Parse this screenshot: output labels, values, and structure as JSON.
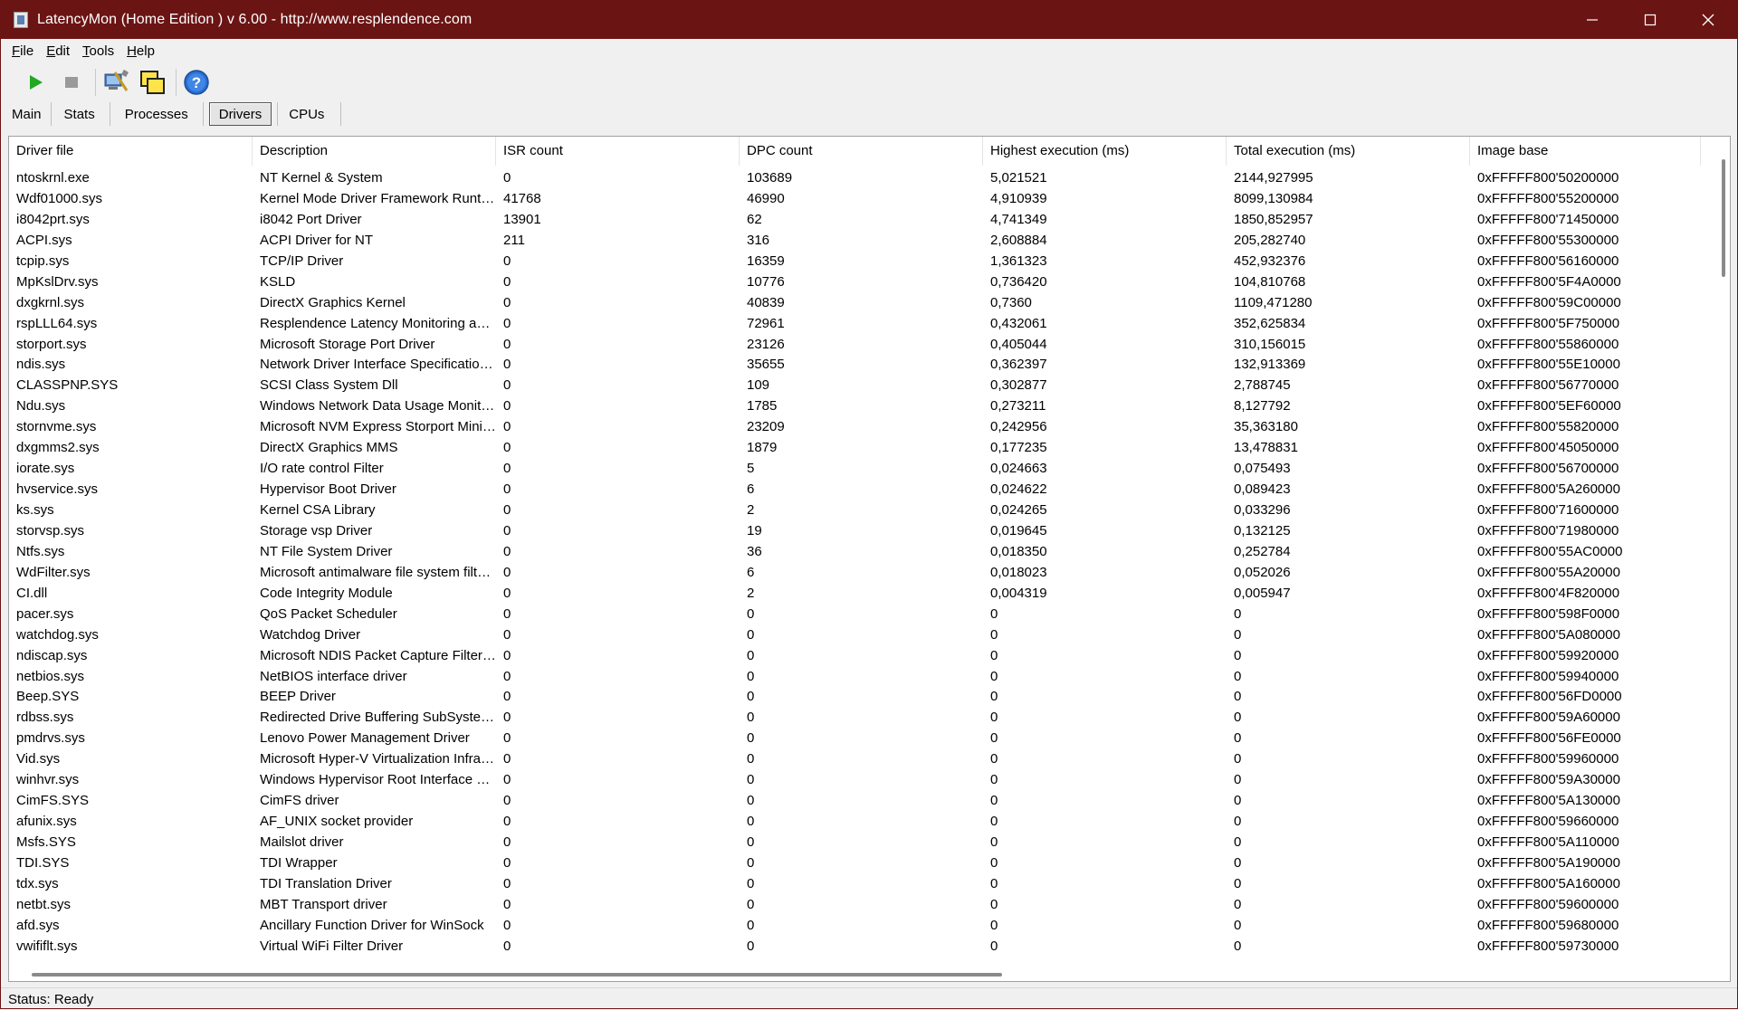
{
  "window": {
    "title": "LatencyMon  (Home Edition )  v 6.00 - http://www.resplendence.com"
  },
  "menu": [
    {
      "label": "File"
    },
    {
      "label": "Edit"
    },
    {
      "label": "Tools"
    },
    {
      "label": "Help"
    }
  ],
  "toolbar": {
    "icons": [
      "play-icon",
      "stop-icon",
      "computer-tools-icon",
      "windows-icon",
      "help-icon"
    ]
  },
  "tabs": [
    {
      "label": "Main",
      "active": false
    },
    {
      "label": "Stats",
      "active": false
    },
    {
      "label": "Processes",
      "active": false
    },
    {
      "label": "Drivers",
      "active": true
    },
    {
      "label": "CPUs",
      "active": false
    }
  ],
  "table": {
    "columns": [
      "Driver file",
      "Description",
      "ISR count",
      "DPC count",
      "Highest execution (ms)",
      "Total execution (ms)",
      "Image base"
    ],
    "rows": [
      [
        "ntoskrnl.exe",
        "NT Kernel & System",
        "0",
        "103689",
        "5,021521",
        "2144,927995",
        "0xFFFFF800'50200000"
      ],
      [
        "Wdf01000.sys",
        "Kernel Mode Driver Framework Runtime",
        "41768",
        "46990",
        "4,910939",
        "8099,130984",
        "0xFFFFF800'55200000"
      ],
      [
        "i8042prt.sys",
        "i8042 Port Driver",
        "13901",
        "62",
        "4,741349",
        "1850,852957",
        "0xFFFFF800'71450000"
      ],
      [
        "ACPI.sys",
        "ACPI Driver for NT",
        "211",
        "316",
        "2,608884",
        "205,282740",
        "0xFFFFF800'55300000"
      ],
      [
        "tcpip.sys",
        "TCP/IP Driver",
        "0",
        "16359",
        "1,361323",
        "452,932376",
        "0xFFFFF800'56160000"
      ],
      [
        "MpKslDrv.sys",
        "KSLD",
        "0",
        "10776",
        "0,736420",
        "104,810768",
        "0xFFFFF800'5F4A0000"
      ],
      [
        "dxgkrnl.sys",
        "DirectX Graphics Kernel",
        "0",
        "40839",
        "0,7360",
        "1109,471280",
        "0xFFFFF800'59C00000"
      ],
      [
        "rspLLL64.sys",
        "Resplendence Latency Monitoring and Auxiliary Kernel Library",
        "0",
        "72961",
        "0,432061",
        "352,625834",
        "0xFFFFF800'5F750000"
      ],
      [
        "storport.sys",
        "Microsoft Storage Port Driver",
        "0",
        "23126",
        "0,405044",
        "310,156015",
        "0xFFFFF800'55860000"
      ],
      [
        "ndis.sys",
        "Network Driver Interface Specification (NDIS)",
        "0",
        "35655",
        "0,362397",
        "132,913369",
        "0xFFFFF800'55E10000"
      ],
      [
        "CLASSPNP.SYS",
        "SCSI Class System Dll",
        "0",
        "109",
        "0,302877",
        "2,788745",
        "0xFFFFF800'56770000"
      ],
      [
        "Ndu.sys",
        "Windows Network Data Usage Monitoring Driver",
        "0",
        "1785",
        "0,273211",
        "8,127792",
        "0xFFFFF800'5EF60000"
      ],
      [
        "stornvme.sys",
        "Microsoft NVM Express Storport Miniport Driver",
        "0",
        "23209",
        "0,242956",
        "35,363180",
        "0xFFFFF800'55820000"
      ],
      [
        "dxgmms2.sys",
        "DirectX Graphics MMS",
        "0",
        "1879",
        "0,177235",
        "13,478831",
        "0xFFFFF800'45050000"
      ],
      [
        "iorate.sys",
        "I/O rate control Filter",
        "0",
        "5",
        "0,024663",
        "0,075493",
        "0xFFFFF800'56700000"
      ],
      [
        "hvservice.sys",
        "Hypervisor Boot Driver",
        "0",
        "6",
        "0,024622",
        "0,089423",
        "0xFFFFF800'5A260000"
      ],
      [
        "ks.sys",
        "Kernel CSA Library",
        "0",
        "2",
        "0,024265",
        "0,033296",
        "0xFFFFF800'71600000"
      ],
      [
        "storvsp.sys",
        "Storage vsp Driver",
        "0",
        "19",
        "0,019645",
        "0,132125",
        "0xFFFFF800'71980000"
      ],
      [
        "Ntfs.sys",
        "NT File System Driver",
        "0",
        "36",
        "0,018350",
        "0,252784",
        "0xFFFFF800'55AC0000"
      ],
      [
        "WdFilter.sys",
        "Microsoft antimalware file system filter driver",
        "0",
        "6",
        "0,018023",
        "0,052026",
        "0xFFFFF800'55A20000"
      ],
      [
        "CI.dll",
        "Code Integrity Module",
        "0",
        "2",
        "0,004319",
        "0,005947",
        "0xFFFFF800'4F820000"
      ],
      [
        "pacer.sys",
        "QoS Packet Scheduler",
        "0",
        "0",
        "0",
        "0",
        "0xFFFFF800'598F0000"
      ],
      [
        "watchdog.sys",
        "Watchdog Driver",
        "0",
        "0",
        "0",
        "0",
        "0xFFFFF800'5A080000"
      ],
      [
        "ndiscap.sys",
        "Microsoft NDIS Packet Capture Filter Driver",
        "0",
        "0",
        "0",
        "0",
        "0xFFFFF800'59920000"
      ],
      [
        "netbios.sys",
        "NetBIOS interface driver",
        "0",
        "0",
        "0",
        "0",
        "0xFFFFF800'59940000"
      ],
      [
        "Beep.SYS",
        "BEEP Driver",
        "0",
        "0",
        "0",
        "0",
        "0xFFFFF800'56FD0000"
      ],
      [
        "rdbss.sys",
        "Redirected Drive Buffering SubSystem Driver",
        "0",
        "0",
        "0",
        "0",
        "0xFFFFF800'59A60000"
      ],
      [
        "pmdrvs.sys",
        "Lenovo Power Management Driver",
        "0",
        "0",
        "0",
        "0",
        "0xFFFFF800'56FE0000"
      ],
      [
        "Vid.sys",
        "Microsoft Hyper-V Virtualization Infrastructure Driver",
        "0",
        "0",
        "0",
        "0",
        "0xFFFFF800'59960000"
      ],
      [
        "winhvr.sys",
        "Windows Hypervisor Root Interface Driver",
        "0",
        "0",
        "0",
        "0",
        "0xFFFFF800'59A30000"
      ],
      [
        "CimFS.SYS",
        "CimFS driver",
        "0",
        "0",
        "0",
        "0",
        "0xFFFFF800'5A130000"
      ],
      [
        "afunix.sys",
        "AF_UNIX socket provider",
        "0",
        "0",
        "0",
        "0",
        "0xFFFFF800'59660000"
      ],
      [
        "Msfs.SYS",
        "Mailslot driver",
        "0",
        "0",
        "0",
        "0",
        "0xFFFFF800'5A110000"
      ],
      [
        "TDI.SYS",
        "TDI Wrapper",
        "0",
        "0",
        "0",
        "0",
        "0xFFFFF800'5A190000"
      ],
      [
        "tdx.sys",
        "TDI Translation Driver",
        "0",
        "0",
        "0",
        "0",
        "0xFFFFF800'5A160000"
      ],
      [
        "netbt.sys",
        "MBT Transport driver",
        "0",
        "0",
        "0",
        "0",
        "0xFFFFF800'59600000"
      ],
      [
        "afd.sys",
        "Ancillary Function Driver for WinSock",
        "0",
        "0",
        "0",
        "0",
        "0xFFFFF800'59680000"
      ],
      [
        "vwififlt.sys",
        "Virtual WiFi Filter Driver",
        "0",
        "0",
        "0",
        "0",
        "0xFFFFF800'59730000"
      ]
    ]
  },
  "status": {
    "text": "Status: Ready"
  },
  "colors": {
    "titlebar": "#6b1414",
    "play": "#22a822",
    "help": "#2a6fd0"
  }
}
